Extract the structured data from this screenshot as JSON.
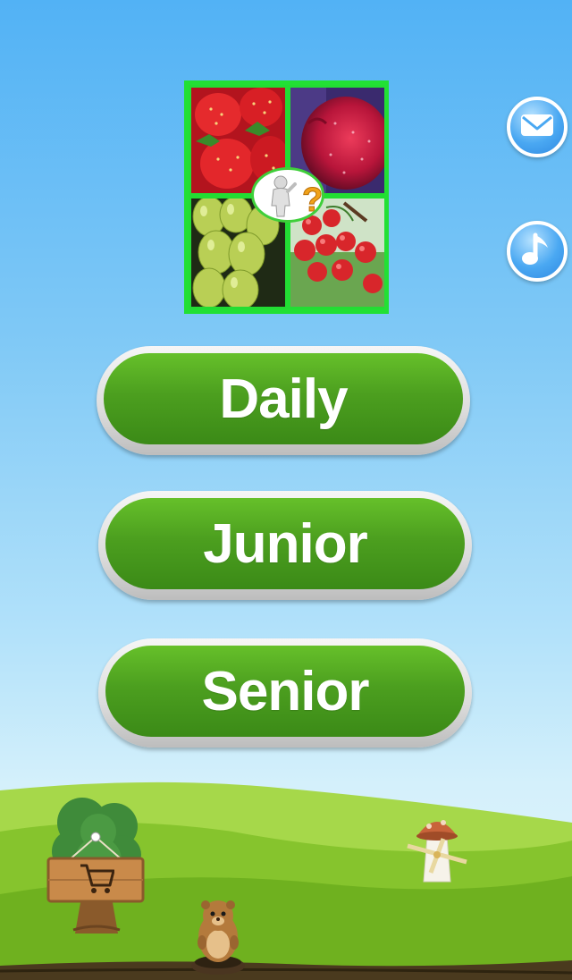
{
  "menu": {
    "buttons": [
      {
        "label": "Daily"
      },
      {
        "label": "Junior"
      },
      {
        "label": "Senior"
      }
    ]
  },
  "logo": {
    "icon": "four-fruit-puzzle-logo",
    "badge_icon": "question-figure-icon"
  },
  "side_buttons": {
    "mail_icon": "mail-icon",
    "music_icon": "music-note-icon"
  },
  "scene": {
    "shop_icon": "shopping-cart-icon",
    "colors": {
      "sky_top": "#52b2f5",
      "button_green": "#4c9f1f",
      "hill_green": "#7fc22b"
    }
  }
}
